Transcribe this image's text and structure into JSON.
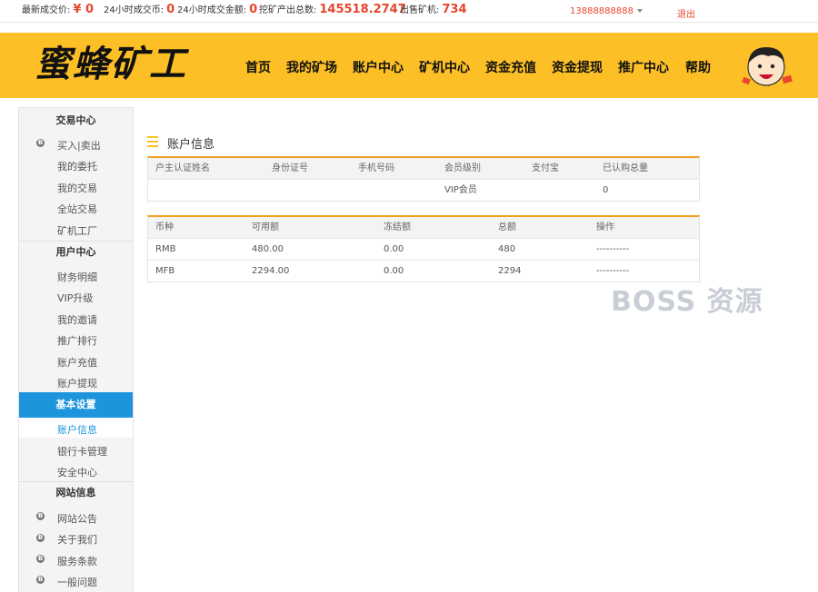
{
  "topbar": {
    "latest_price_label": "最新成交价:",
    "latest_price_value": "¥ 0",
    "coins_24h_label": "24小时成交币:",
    "coins_24h_value": "0",
    "amount_24h_label": "24小时成交金额:",
    "amount_24h_value": "0",
    "mining_total_label": "挖矿产出总数:",
    "mining_total_value": "145518.2747",
    "machines_sold_label": "出售矿机:",
    "machines_sold_value": "734",
    "username": "13888888888",
    "logout": "退出"
  },
  "header": {
    "logo": "蜜蜂矿工",
    "nav": [
      "首页",
      "我的矿场",
      "账户中心",
      "矿机中心",
      "资金充值",
      "资金提现",
      "推广中心",
      "帮助"
    ]
  },
  "sidebar": {
    "trade_center": "交易中心",
    "trade_items": [
      "买入|卖出",
      "我的委托",
      "我的交易",
      "全站交易",
      "矿机工厂"
    ],
    "user_center": "用户中心",
    "user_items": [
      "财务明细",
      "VIP升级",
      "我的邀请",
      "推广排行",
      "账户充值",
      "账户提现"
    ],
    "basic_settings": "基本设置",
    "basic_items": [
      "账户信息",
      "银行卡管理",
      "安全中心"
    ],
    "site_info": "网站信息",
    "site_items": [
      "网站公告",
      "关于我们",
      "服务条款",
      "一般问题"
    ]
  },
  "main": {
    "title": "账户信息",
    "account_table": {
      "headers": [
        "户主认证姓名",
        "身份证号",
        "手机号码",
        "会员级别",
        "支付宝",
        "已认购总量"
      ],
      "row": [
        "",
        "",
        "",
        "VIP会员",
        "",
        "0"
      ]
    },
    "balance_table": {
      "headers": [
        "币种",
        "可用额",
        "冻结额",
        "总额",
        "操作"
      ],
      "rows": [
        [
          "RMB",
          "480.00",
          "0.00",
          "480",
          "----------"
        ],
        [
          "MFB",
          "2294.00",
          "0.00",
          "2294",
          "----------"
        ]
      ]
    }
  },
  "watermark": "BOSS 资源",
  "colors": {
    "accent": "#fcbf25",
    "active": "#1c95dd",
    "highlight": "#e8452c"
  }
}
